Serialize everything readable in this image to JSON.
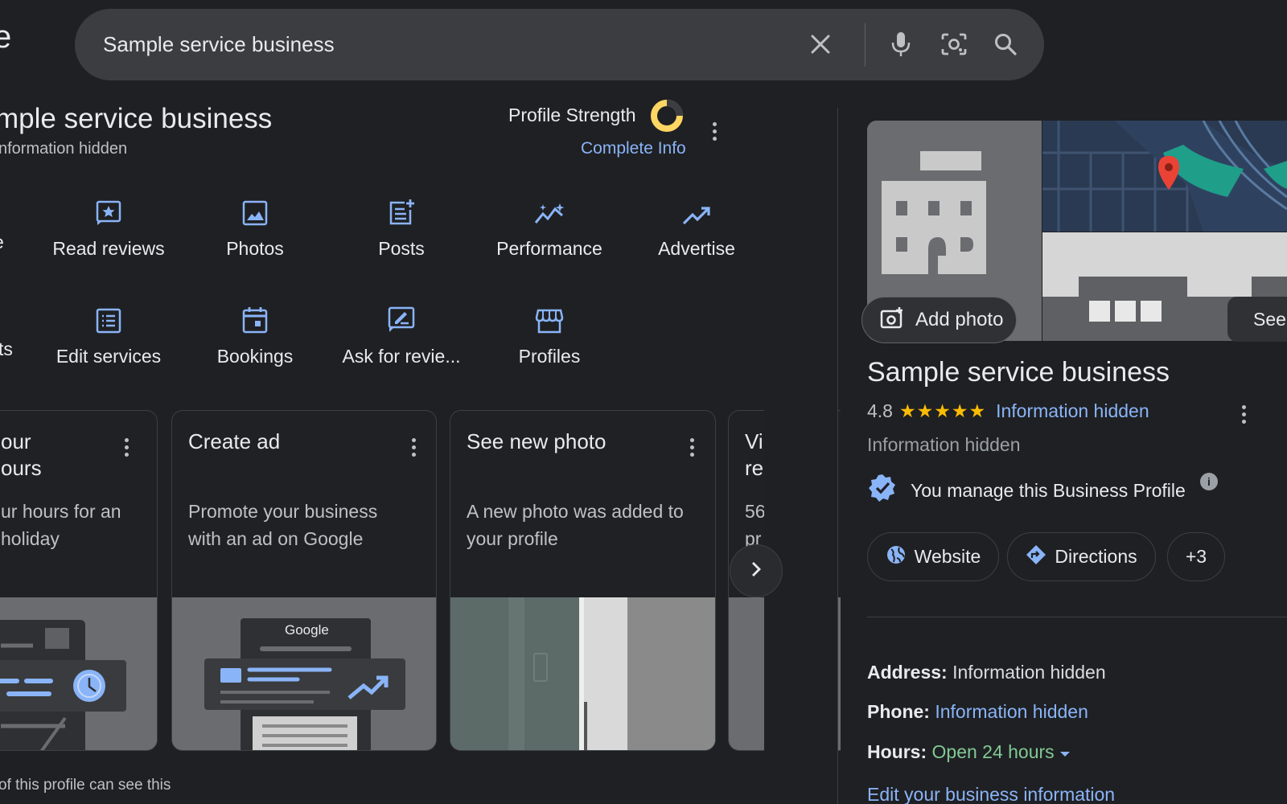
{
  "header": {
    "logo_fragment": "e",
    "search_query": "Sample service business",
    "icons": [
      "close-icon",
      "mic-icon",
      "lens-icon",
      "search-icon"
    ]
  },
  "profile": {
    "title": "mple service business",
    "subtitle": "nformation hidden",
    "strength_label": "Profile Strength",
    "complete_info": "Complete Info"
  },
  "actions_row1": {
    "fragment": "e",
    "items": [
      {
        "label": "Read reviews",
        "icon": "star-review-icon"
      },
      {
        "label": "Photos",
        "icon": "image-icon"
      },
      {
        "label": "Posts",
        "icon": "post-add-icon"
      },
      {
        "label": "Performance",
        "icon": "performance-icon"
      },
      {
        "label": "Advertise",
        "icon": "trending-up-icon"
      }
    ]
  },
  "actions_row2": {
    "fragment": "ts",
    "items": [
      {
        "label": "Edit services",
        "icon": "list-icon"
      },
      {
        "label": "Bookings",
        "icon": "calendar-icon"
      },
      {
        "label": "Ask for revie...",
        "icon": "rate-review-icon"
      },
      {
        "label": "Profiles",
        "icon": "storefront-icon"
      }
    ]
  },
  "cards": [
    {
      "title": "our\nours",
      "body": "ur hours for an\nholiday"
    },
    {
      "title": "Create ad",
      "body": "Promote your business\nwith an ad on Google",
      "image_text": "Google"
    },
    {
      "title": "See new photo",
      "body": "A new photo was added to\nyour profile"
    },
    {
      "title": "Vi\nre",
      "body": "56\npr"
    }
  ],
  "footer_note": "of this profile can see this",
  "panel": {
    "add_photo": "Add photo",
    "see_label": "See",
    "title": "Sample service business",
    "rating": "4.8",
    "stars": "★★★★★",
    "rating_link": "Information hidden",
    "category": "Information hidden",
    "manage_text": "You manage this Business Profile",
    "chips": {
      "website": "Website",
      "directions": "Directions",
      "more": "+3"
    },
    "address_label": "Address:",
    "address_value": "Information hidden",
    "phone_label": "Phone:",
    "phone_value": "Information hidden",
    "hours_label": "Hours:",
    "hours_value": "Open 24 hours",
    "edit_link": "Edit your business information"
  },
  "colors": {
    "background": "#1f2023",
    "link": "#8ab4f8",
    "star": "#fbbc04",
    "open": "#81c995",
    "strength_ring": "#fdd663"
  }
}
